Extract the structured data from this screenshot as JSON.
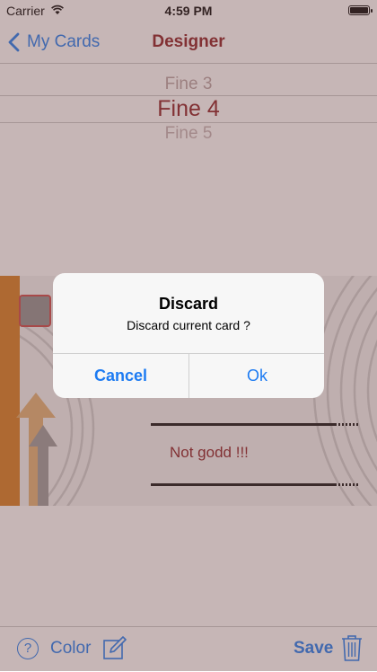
{
  "status_bar": {
    "carrier": "Carrier",
    "time": "4:59 PM"
  },
  "nav": {
    "back_label": "My Cards",
    "title": "Designer"
  },
  "picker": {
    "previous": "Fine 3",
    "selected": "Fine 4",
    "next": "Fine 5"
  },
  "card": {
    "text": "Not godd !!!"
  },
  "toolbar": {
    "help_label": "?",
    "color_label": "Color",
    "save_label": "Save"
  },
  "alert": {
    "title": "Discard",
    "message": "Discard current card ?",
    "cancel_label": "Cancel",
    "ok_label": "Ok"
  },
  "colors": {
    "accent": "#1d7bf2",
    "brand": "#8a1b20",
    "card_strip": "#d67a1c",
    "overlay": "#785252"
  }
}
